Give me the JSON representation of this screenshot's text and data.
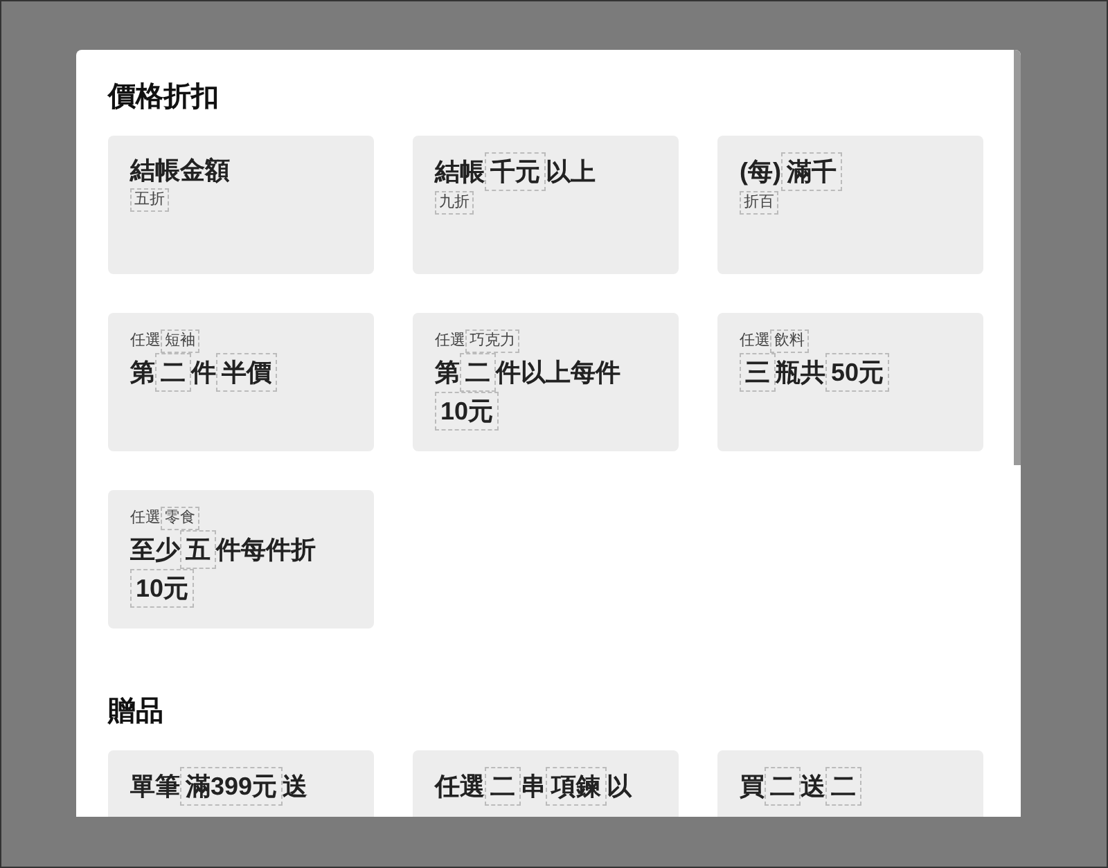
{
  "sections": [
    {
      "title": "價格折扣",
      "cards": [
        {
          "lines": [
            {
              "kind": "title",
              "segments": [
                {
                  "text": "結帳金額",
                  "slot": false
                }
              ]
            },
            {
              "kind": "label",
              "segments": [
                {
                  "text": "五折",
                  "slot": true
                }
              ]
            }
          ]
        },
        {
          "lines": [
            {
              "kind": "title",
              "segments": [
                {
                  "text": "結帳",
                  "slot": false
                },
                {
                  "text": "千元",
                  "slot": true
                },
                {
                  "text": "以上",
                  "slot": false
                }
              ]
            },
            {
              "kind": "label",
              "segments": [
                {
                  "text": "九折",
                  "slot": true
                }
              ]
            }
          ]
        },
        {
          "lines": [
            {
              "kind": "title",
              "segments": [
                {
                  "text": "(每)",
                  "slot": false
                },
                {
                  "text": "滿千",
                  "slot": true
                }
              ]
            },
            {
              "kind": "label",
              "segments": [
                {
                  "text": "折百",
                  "slot": true
                }
              ]
            }
          ]
        },
        {
          "lines": [
            {
              "kind": "label",
              "segments": [
                {
                  "text": "任選",
                  "slot": false
                },
                {
                  "text": "短袖",
                  "slot": true
                }
              ]
            },
            {
              "kind": "title",
              "segments": [
                {
                  "text": "第",
                  "slot": false
                },
                {
                  "text": "二",
                  "slot": true
                },
                {
                  "text": "件",
                  "slot": false
                },
                {
                  "text": "半價",
                  "slot": true
                }
              ]
            }
          ]
        },
        {
          "lines": [
            {
              "kind": "label",
              "segments": [
                {
                  "text": "任選",
                  "slot": false
                },
                {
                  "text": "巧克力",
                  "slot": true
                }
              ]
            },
            {
              "kind": "title",
              "segments": [
                {
                  "text": "第",
                  "slot": false
                },
                {
                  "text": "二",
                  "slot": true
                },
                {
                  "text": "件以上每件",
                  "slot": false
                },
                {
                  "text": "10元",
                  "slot": true
                }
              ]
            }
          ]
        },
        {
          "lines": [
            {
              "kind": "label",
              "segments": [
                {
                  "text": "任選",
                  "slot": false
                },
                {
                  "text": "飲料",
                  "slot": true
                }
              ]
            },
            {
              "kind": "title",
              "segments": [
                {
                  "text": "三",
                  "slot": true
                },
                {
                  "text": "瓶共",
                  "slot": false
                },
                {
                  "text": "50元",
                  "slot": true
                }
              ]
            }
          ]
        },
        {
          "lines": [
            {
              "kind": "label",
              "segments": [
                {
                  "text": "任選",
                  "slot": false
                },
                {
                  "text": "零食",
                  "slot": true
                }
              ]
            },
            {
              "kind": "title",
              "segments": [
                {
                  "text": "至少",
                  "slot": false
                },
                {
                  "text": "五",
                  "slot": true
                },
                {
                  "text": "件每件折",
                  "slot": false
                },
                {
                  "text": "10元",
                  "slot": true
                }
              ]
            }
          ]
        }
      ]
    },
    {
      "title": "贈品",
      "cards": [
        {
          "lines": [
            {
              "kind": "title",
              "segments": [
                {
                  "text": "單筆",
                  "slot": false
                },
                {
                  "text": "滿399元",
                  "slot": true
                },
                {
                  "text": "送",
                  "slot": false
                }
              ]
            }
          ]
        },
        {
          "lines": [
            {
              "kind": "title",
              "segments": [
                {
                  "text": "任選",
                  "slot": false
                },
                {
                  "text": "二",
                  "slot": true
                },
                {
                  "text": "串",
                  "slot": false
                },
                {
                  "text": "項鍊",
                  "slot": true
                },
                {
                  "text": "以",
                  "slot": false
                }
              ]
            }
          ]
        },
        {
          "lines": [
            {
              "kind": "title",
              "segments": [
                {
                  "text": "買",
                  "slot": false
                },
                {
                  "text": "二",
                  "slot": true
                },
                {
                  "text": "送",
                  "slot": false
                },
                {
                  "text": "二",
                  "slot": true
                }
              ]
            }
          ]
        }
      ]
    }
  ]
}
